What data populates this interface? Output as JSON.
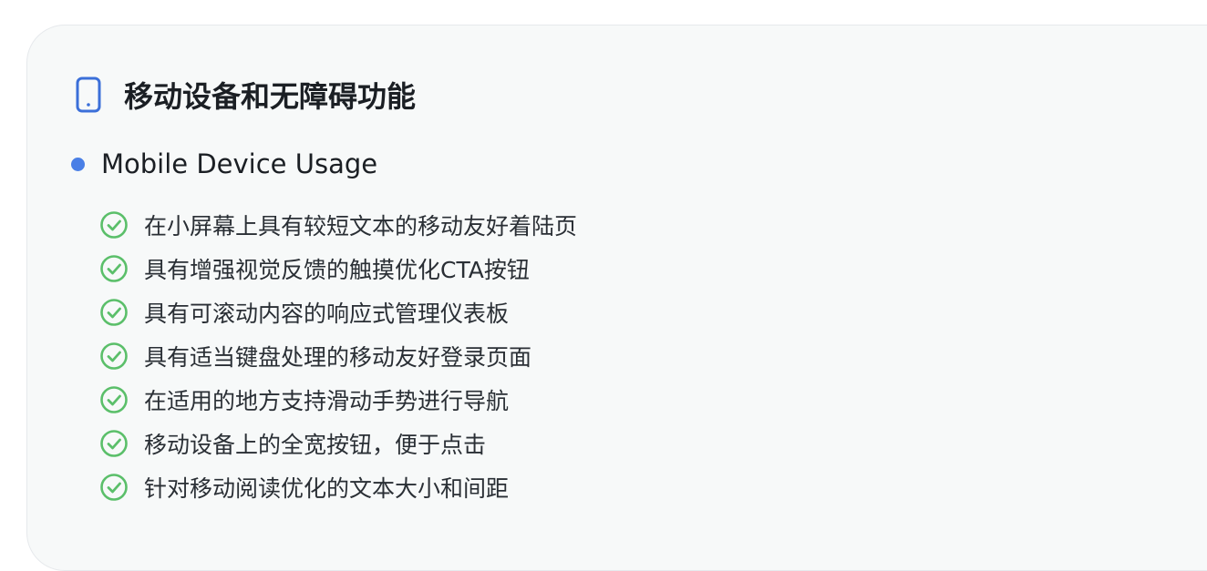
{
  "panel": {
    "title": "移动设备和无障碍功能",
    "icon": "smartphone-icon",
    "accent_color": "#3b6fd9"
  },
  "section": {
    "bullet_color": "#4a7fe6",
    "label": "Mobile Device Usage",
    "check_color": "#5bbf6a",
    "items": [
      {
        "label": "在小屏幕上具有较短文本的移动友好着陆页"
      },
      {
        "label": "具有增强视觉反馈的触摸优化CTA按钮"
      },
      {
        "label": "具有可滚动内容的响应式管理仪表板"
      },
      {
        "label": "具有适当键盘处理的移动友好登录页面"
      },
      {
        "label": "在适用的地方支持滑动手势进行导航"
      },
      {
        "label": "移动设备上的全宽按钮，便于点击"
      },
      {
        "label": "针对移动阅读优化的文本大小和间距"
      }
    ]
  }
}
